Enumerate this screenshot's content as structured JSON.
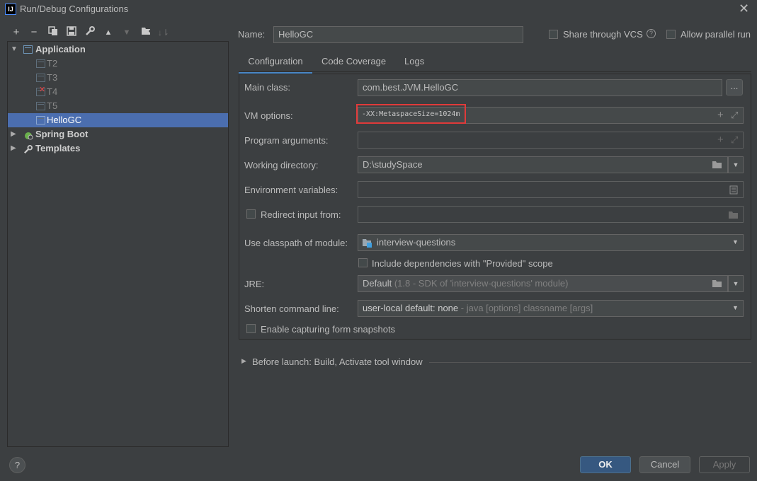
{
  "window": {
    "title": "Run/Debug Configurations",
    "app_icon_text": "IJ"
  },
  "tree": {
    "application_label": "Application",
    "children": [
      "T2",
      "T3",
      "T4",
      "T5",
      "HelloGC"
    ],
    "spring_boot_label": "Spring Boot",
    "templates_label": "Templates"
  },
  "form": {
    "name_label": "Name:",
    "name_value": "HelloGC",
    "share_vcs_label": "Share through VCS",
    "allow_parallel_label": "Allow parallel run",
    "tabs": [
      "Configuration",
      "Code Coverage",
      "Logs"
    ],
    "main_class_label": "Main class:",
    "main_class_value": "com.best.JVM.HelloGC",
    "browse_label": "...",
    "vm_options_label": "VM options:",
    "vm_options_value": "-XX:MetaspaceSize=1024m",
    "program_args_label": "Program arguments:",
    "program_args_value": "",
    "working_dir_label": "Working directory:",
    "working_dir_value": "D:\\studySpace",
    "env_vars_label": "Environment variables:",
    "env_vars_value": "",
    "redirect_input_label": "Redirect input from:",
    "classpath_label": "Use classpath of module:",
    "classpath_value": "interview-questions",
    "include_deps_label": "Include dependencies with \"Provided\" scope",
    "jre_label": "JRE:",
    "jre_value": "Default",
    "jre_hint": "(1.8 - SDK of 'interview-questions' module)",
    "shorten_label": "Shorten command line:",
    "shorten_value": "user-local default: none",
    "shorten_hint": "- java [options] classname [args]",
    "snapshots_label": "Enable capturing form snapshots",
    "before_launch_label": "Before launch: Build, Activate tool window"
  },
  "buttons": {
    "ok": "OK",
    "cancel": "Cancel",
    "apply": "Apply",
    "help": "?"
  },
  "colors": {
    "background": "#3c3f41",
    "selection": "#4b6eaf",
    "primary_button": "#365880",
    "highlight_box": "#e03a3a"
  }
}
